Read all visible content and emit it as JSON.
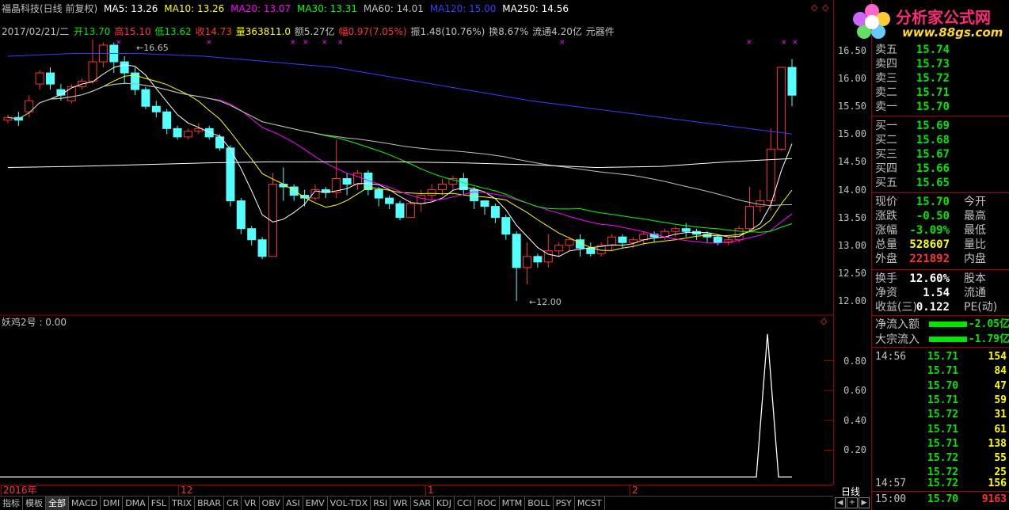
{
  "header": {
    "stock_title": "福晶科技(日线 前复权)",
    "ma5": "MA5: 13.26",
    "ma10": "MA10: 13.26",
    "ma20": "MA20: 13.07",
    "ma30": "MA30: 13.31",
    "ma60": "MA60: 14.01",
    "ma120": "MA120: 15.00",
    "ma250": "MA250: 14.56",
    "date_info": "2017/02/21/二",
    "open": "开13.70",
    "high": "高15.10",
    "low": "低13.62",
    "close": "收14.73",
    "volume": "量363811.0",
    "amount": "额5.27亿",
    "change": "幅0.97(7.05%)",
    "amplitude": "振1.48(10.76%)",
    "turnover": "换8.67%",
    "float": "流通4.20亿",
    "sector": "元器件"
  },
  "indicator": {
    "name": "妖鸡2号 : 0.00"
  },
  "colors": {
    "ma5": "#ffffff",
    "ma10": "#ffff00",
    "ma20": "#ff00ff",
    "ma30": "#00ff00",
    "ma60": "#c0c0c0",
    "ma120": "#3c3cff",
    "ma250": "#ffffff",
    "up": "#ff3232",
    "down": "#54ffff"
  },
  "annotations": {
    "high_label": "16.65",
    "low_label": "12.00"
  },
  "chart_data": {
    "type": "candlestick",
    "y_ticks": [
      "16.50",
      "16.00",
      "15.50",
      "15.00",
      "14.50",
      "14.00",
      "13.50",
      "13.00",
      "12.50",
      "12.00"
    ],
    "y_range": [
      11.8,
      16.8
    ],
    "x_labels": [
      "2016年",
      "12",
      "1",
      "2"
    ],
    "candles": [
      [
        15.25,
        15.3,
        15.2,
        15.35
      ],
      [
        15.3,
        15.25,
        15.15,
        15.4
      ],
      [
        15.4,
        15.6,
        15.3,
        15.7
      ],
      [
        15.9,
        16.1,
        15.8,
        16.15
      ],
      [
        16.1,
        15.9,
        15.8,
        16.2
      ],
      [
        15.8,
        15.7,
        15.6,
        15.9
      ],
      [
        15.6,
        15.85,
        15.55,
        15.9
      ],
      [
        15.85,
        15.95,
        15.8,
        16.0
      ],
      [
        15.95,
        16.3,
        15.9,
        16.7
      ],
      [
        16.3,
        16.6,
        16.2,
        16.65
      ],
      [
        16.6,
        16.3,
        16.1,
        16.65
      ],
      [
        16.3,
        16.1,
        15.9,
        16.4
      ],
      [
        16.1,
        15.8,
        15.7,
        16.2
      ],
      [
        15.8,
        15.5,
        15.45,
        15.85
      ],
      [
        15.5,
        15.4,
        15.3,
        15.6
      ],
      [
        15.4,
        15.1,
        15.0,
        15.45
      ],
      [
        15.1,
        14.95,
        14.9,
        15.15
      ],
      [
        14.95,
        15.05,
        14.9,
        15.1
      ],
      [
        15.05,
        15.1,
        15.0,
        15.2
      ],
      [
        15.1,
        14.95,
        14.9,
        15.15
      ],
      [
        14.95,
        14.75,
        14.7,
        15.0
      ],
      [
        14.75,
        13.8,
        13.7,
        14.8
      ],
      [
        13.8,
        13.3,
        13.2,
        13.85
      ],
      [
        13.3,
        13.1,
        13.0,
        13.35
      ],
      [
        13.1,
        12.8,
        12.75,
        13.15
      ],
      [
        12.8,
        14.1,
        12.8,
        14.3
      ],
      [
        14.1,
        14.05,
        13.8,
        14.4
      ],
      [
        14.05,
        13.9,
        13.8,
        14.1
      ],
      [
        13.9,
        13.85,
        13.7,
        14.0
      ],
      [
        13.85,
        14.0,
        13.8,
        14.1
      ],
      [
        14.0,
        13.95,
        13.85,
        14.05
      ],
      [
        13.95,
        14.2,
        13.85,
        14.9
      ],
      [
        14.2,
        14.1,
        13.9,
        14.3
      ],
      [
        14.1,
        14.3,
        14.0,
        14.35
      ],
      [
        14.3,
        14.0,
        13.9,
        14.35
      ],
      [
        14.0,
        13.85,
        13.7,
        14.05
      ],
      [
        13.85,
        13.75,
        13.65,
        13.9
      ],
      [
        13.75,
        13.5,
        13.45,
        13.8
      ],
      [
        13.5,
        13.75,
        13.55,
        13.8
      ],
      [
        13.75,
        13.9,
        13.6,
        14.0
      ],
      [
        13.9,
        14.0,
        13.8,
        14.1
      ],
      [
        14.0,
        14.1,
        13.9,
        14.2
      ],
      [
        14.1,
        14.2,
        14.0,
        14.25
      ],
      [
        14.2,
        14.0,
        13.9,
        14.3
      ],
      [
        14.0,
        13.8,
        13.65,
        14.05
      ],
      [
        13.8,
        13.7,
        13.55,
        13.8
      ],
      [
        13.7,
        13.5,
        13.4,
        13.75
      ],
      [
        13.5,
        13.2,
        13.1,
        13.55
      ],
      [
        13.2,
        12.6,
        12.0,
        13.25
      ],
      [
        12.6,
        12.8,
        12.3,
        13.05
      ],
      [
        12.8,
        12.7,
        12.6,
        12.85
      ],
      [
        12.7,
        12.9,
        12.6,
        13.2
      ],
      [
        12.9,
        13.0,
        12.8,
        13.05
      ],
      [
        13.0,
        13.1,
        12.9,
        13.15
      ],
      [
        13.1,
        12.95,
        12.8,
        13.2
      ],
      [
        12.95,
        12.85,
        12.8,
        13.05
      ],
      [
        12.85,
        13.0,
        12.8,
        13.05
      ],
      [
        13.0,
        13.15,
        12.9,
        13.2
      ],
      [
        13.15,
        13.05,
        12.95,
        13.2
      ],
      [
        13.05,
        13.1,
        12.95,
        13.15
      ],
      [
        13.1,
        13.2,
        13.0,
        13.25
      ],
      [
        13.2,
        13.15,
        13.05,
        13.25
      ],
      [
        13.15,
        13.25,
        13.1,
        13.3
      ],
      [
        13.25,
        13.3,
        13.15,
        13.35
      ],
      [
        13.3,
        13.25,
        13.15,
        13.4
      ],
      [
        13.25,
        13.2,
        13.1,
        13.3
      ],
      [
        13.2,
        13.15,
        13.05,
        13.25
      ],
      [
        13.15,
        13.05,
        13.0,
        13.2
      ],
      [
        13.05,
        13.1,
        13.0,
        13.15
      ],
      [
        13.1,
        13.3,
        13.05,
        13.35
      ],
      [
        13.3,
        13.7,
        13.25,
        14.05
      ],
      [
        13.7,
        13.8,
        13.6,
        14.0
      ],
      [
        13.8,
        14.73,
        13.62,
        15.1
      ],
      [
        14.73,
        16.2,
        14.7,
        16.2
      ],
      [
        16.2,
        15.7,
        15.5,
        16.35
      ]
    ],
    "indicator_ticks": [
      "0.80",
      "0.60",
      "0.40",
      "0.20"
    ],
    "indicator_range": [
      0,
      1.0
    ]
  },
  "side": {
    "asks": [
      {
        "label": "卖五",
        "price": "15.74",
        "vol": ""
      },
      {
        "label": "卖四",
        "price": "15.73",
        "vol": ""
      },
      {
        "label": "卖三",
        "price": "15.72",
        "vol": ""
      },
      {
        "label": "卖二",
        "price": "15.71",
        "vol": ""
      },
      {
        "label": "卖一",
        "price": "15.70",
        "vol": ""
      }
    ],
    "bids": [
      {
        "label": "买一",
        "price": "15.69"
      },
      {
        "label": "买二",
        "price": "15.68"
      },
      {
        "label": "买三",
        "price": "15.67"
      },
      {
        "label": "买四",
        "price": "15.66"
      },
      {
        "label": "买五",
        "price": "15.65"
      }
    ],
    "quote": [
      {
        "l": "现价",
        "v": "15.70",
        "c": "dn",
        "l2": "今开"
      },
      {
        "l": "涨跌",
        "v": "-0.50",
        "c": "dn",
        "l2": "最高"
      },
      {
        "l": "涨幅",
        "v": "-3.09%",
        "c": "dn",
        "l2": "最低"
      },
      {
        "l": "总量",
        "v": "528607",
        "c": "yl",
        "l2": "量比"
      },
      {
        "l": "外盘",
        "v": "221892",
        "c": "up",
        "l2": "内盘"
      }
    ],
    "stats": [
      {
        "l": "换手",
        "v": "12.60%",
        "l2": "股本"
      },
      {
        "l": "净资",
        "v": "1.54",
        "l2": "流通"
      },
      {
        "l": "收益(三)",
        "v": "0.122",
        "l2": "PE(动)"
      }
    ],
    "flow": [
      {
        "l": "净流入额",
        "v": "-2.05亿"
      },
      {
        "l": "大宗流入",
        "v": "-1.79亿"
      }
    ],
    "ticks": [
      {
        "t": "14:56",
        "p": "15.71",
        "v": "154"
      },
      {
        "t": "",
        "p": "15.71",
        "v": "84"
      },
      {
        "t": "",
        "p": "15.70",
        "v": "47"
      },
      {
        "t": "",
        "p": "15.71",
        "v": "59"
      },
      {
        "t": "",
        "p": "15.72",
        "v": "31"
      },
      {
        "t": "",
        "p": "15.71",
        "v": "61"
      },
      {
        "t": "",
        "p": "15.71",
        "v": "138"
      },
      {
        "t": "",
        "p": "15.72",
        "v": "55"
      },
      {
        "t": "",
        "p": "15.72",
        "v": "25"
      },
      {
        "t": "14:57",
        "p": "15.72",
        "v": "156"
      },
      {
        "t": "15:00",
        "p": "15.70",
        "v": "9163"
      }
    ]
  },
  "bottom": {
    "period": "日线"
  },
  "tabs": [
    "指标",
    "模板",
    "全部",
    "MACD",
    "DMI",
    "DMA",
    "FSL",
    "TRIX",
    "BRAR",
    "CR",
    "VR",
    "OBV",
    "ASI",
    "EMV",
    "VOL-TDX",
    "RSI",
    "WR",
    "SAR",
    "KDJ",
    "CCI",
    "ROC",
    "MTM",
    "BOLL",
    "PSY",
    "MCST"
  ],
  "logo": {
    "title": "分析家公式网",
    "url": "www.88gs.com"
  }
}
